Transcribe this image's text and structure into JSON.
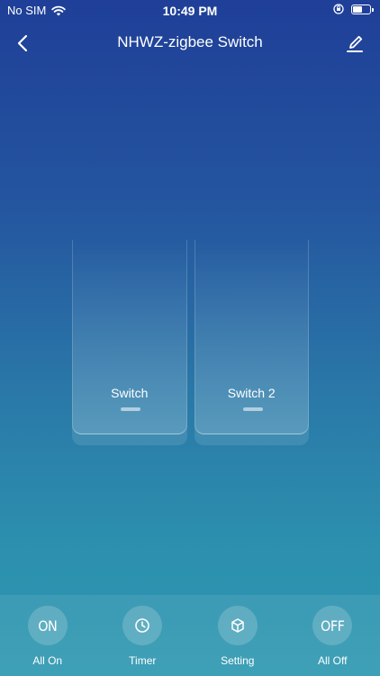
{
  "status_bar": {
    "carrier": "No SIM",
    "time": "10:49 PM",
    "battery_level": 0.6
  },
  "nav": {
    "title": "NHWZ-zigbee Switch",
    "back_icon": "chevron-left-icon",
    "edit_icon": "pencil-icon"
  },
  "switches": [
    {
      "label": "Switch"
    },
    {
      "label": "Switch 2"
    }
  ],
  "actions": [
    {
      "icon_text": "ON",
      "label": "All On"
    },
    {
      "icon": "clock-icon",
      "label": "Timer"
    },
    {
      "icon": "cube-icon",
      "label": "Setting"
    },
    {
      "icon_text": "OFF",
      "label": "All Off"
    }
  ]
}
